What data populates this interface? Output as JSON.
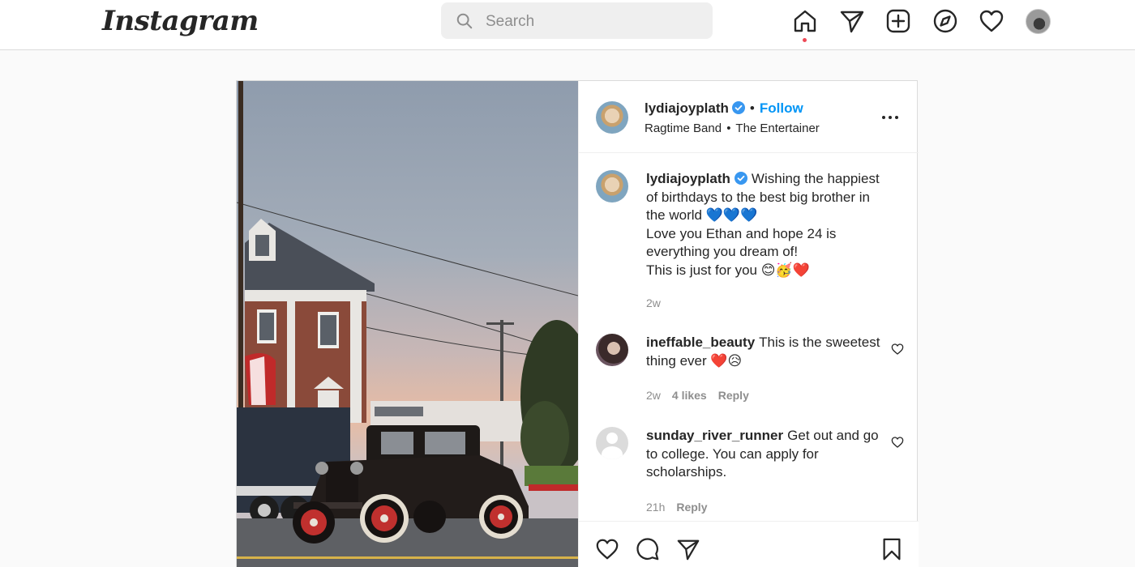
{
  "topbar": {
    "logo": "Instagram",
    "search_placeholder": "Search",
    "icons": [
      "home-icon",
      "direct-icon",
      "new-post-icon",
      "explore-icon",
      "activity-heart-icon",
      "profile-avatar"
    ]
  },
  "post": {
    "header": {
      "username": "lydiajoyplath",
      "separator": "•",
      "follow_label": "Follow",
      "audio_artist": "Ragtime Band",
      "audio_sep": "•",
      "audio_title": "The Entertainer"
    },
    "caption": {
      "username": "lydiajoyplath",
      "line1": "Wishing the happiest of birthdays to the best big brother in the world 💙💙💙",
      "line2": "Love you Ethan and hope 24 is everything you dream of!",
      "line3": "This is just for you 😊🥳❤️",
      "time": "2w"
    },
    "comments": [
      {
        "username": "ineffable_beauty",
        "text": "This is the sweetest thing ever ❤️😥",
        "time": "2w",
        "likes": "4 likes",
        "reply": "Reply"
      },
      {
        "username": "sunday_river_runner",
        "text": "Get out and go to college. You can apply for scholarships.",
        "time": "21h",
        "reply": "Reply"
      }
    ]
  },
  "colors": {
    "accent": "#0095f6",
    "verified": "#3897f0",
    "notification": "#ed4956"
  }
}
